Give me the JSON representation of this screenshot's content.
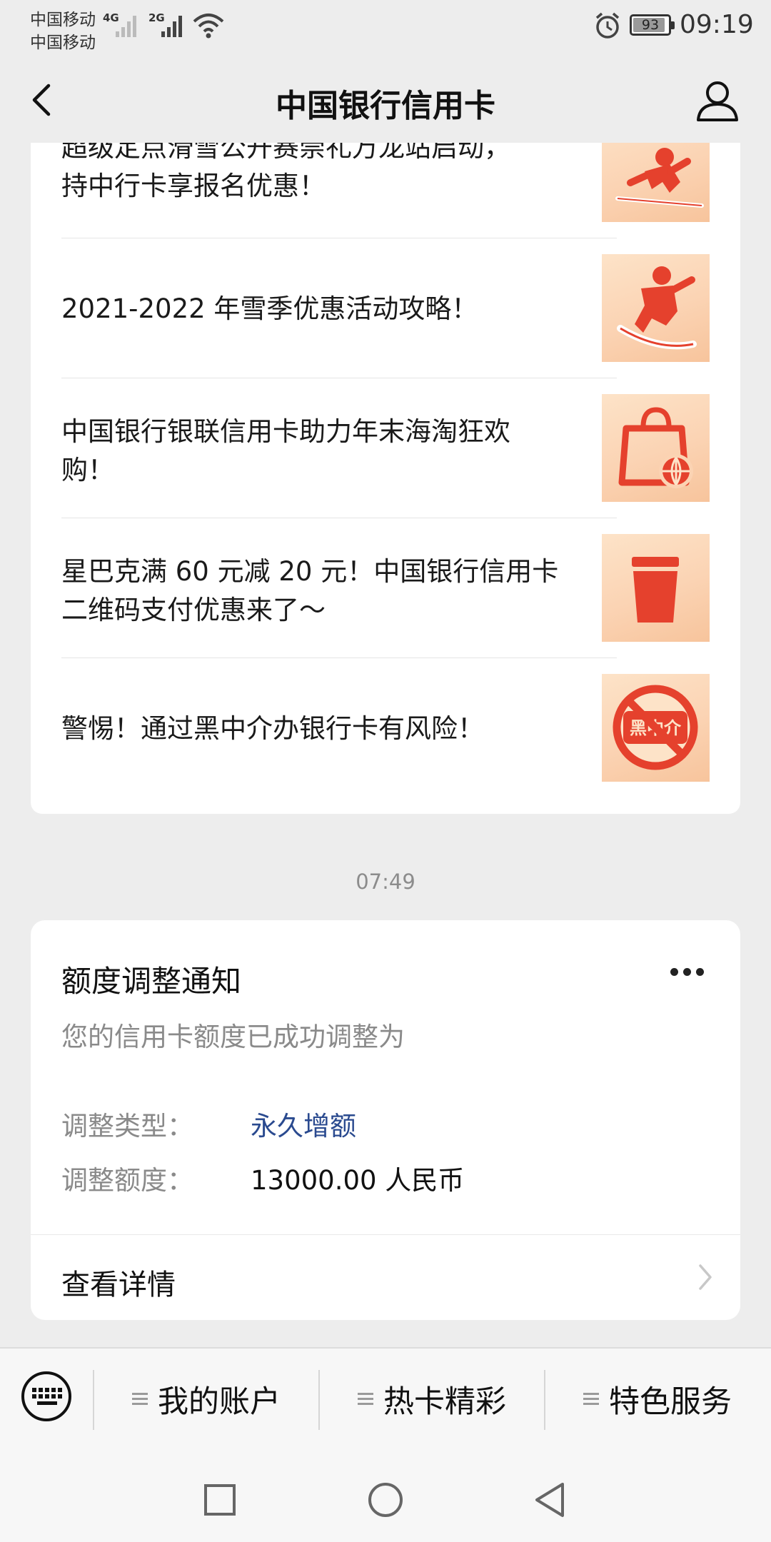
{
  "status_bar": {
    "carrier_1": "中国移动",
    "carrier_2": "中国移动",
    "net_1": "4G",
    "net_2": "2G",
    "battery": "93",
    "time": "09:19"
  },
  "nav": {
    "title": "中国银行信用卡",
    "back_icon": "chevron-left-icon",
    "profile_icon": "user-icon"
  },
  "news": [
    {
      "line1": "超级定点滑雪公开赛崇礼万龙站启动，",
      "line2": "持中行卡享报名优惠！",
      "icon": "skier-icon"
    },
    {
      "line1": "2021-2022 年雪季优惠活动攻略！",
      "line2": "",
      "icon": "snowboarder-icon"
    },
    {
      "line1": "中国银行银联信用卡助力年末海淘狂欢",
      "line2": "购！",
      "icon": "shopping-bag-globe-icon"
    },
    {
      "line1": "星巴克满 60 元减 20 元！中国银行信用卡",
      "line2": "二维码支付优惠来了～",
      "icon": "coffee-cup-icon"
    },
    {
      "line1": "警惕！通过黑中介办银行卡有风险！",
      "line2": "",
      "icon": "no-agent-icon",
      "icon_text": "黑中介"
    }
  ],
  "timestamp": "07:49",
  "notice": {
    "title": "额度调整通知",
    "description": "您的信用卡额度已成功调整为",
    "type_label": "调整类型：",
    "type_value": "永久增额",
    "amount_label": "调整额度：",
    "amount_value": "13000.00 人民币",
    "link_label": "查看详情"
  },
  "bottom_menu": {
    "items": [
      "我的账户",
      "热卡精彩",
      "特色服务"
    ]
  },
  "colors": {
    "accent_red": "#e5412d",
    "link_blue": "#2a4a8f",
    "background": "#ededed"
  }
}
